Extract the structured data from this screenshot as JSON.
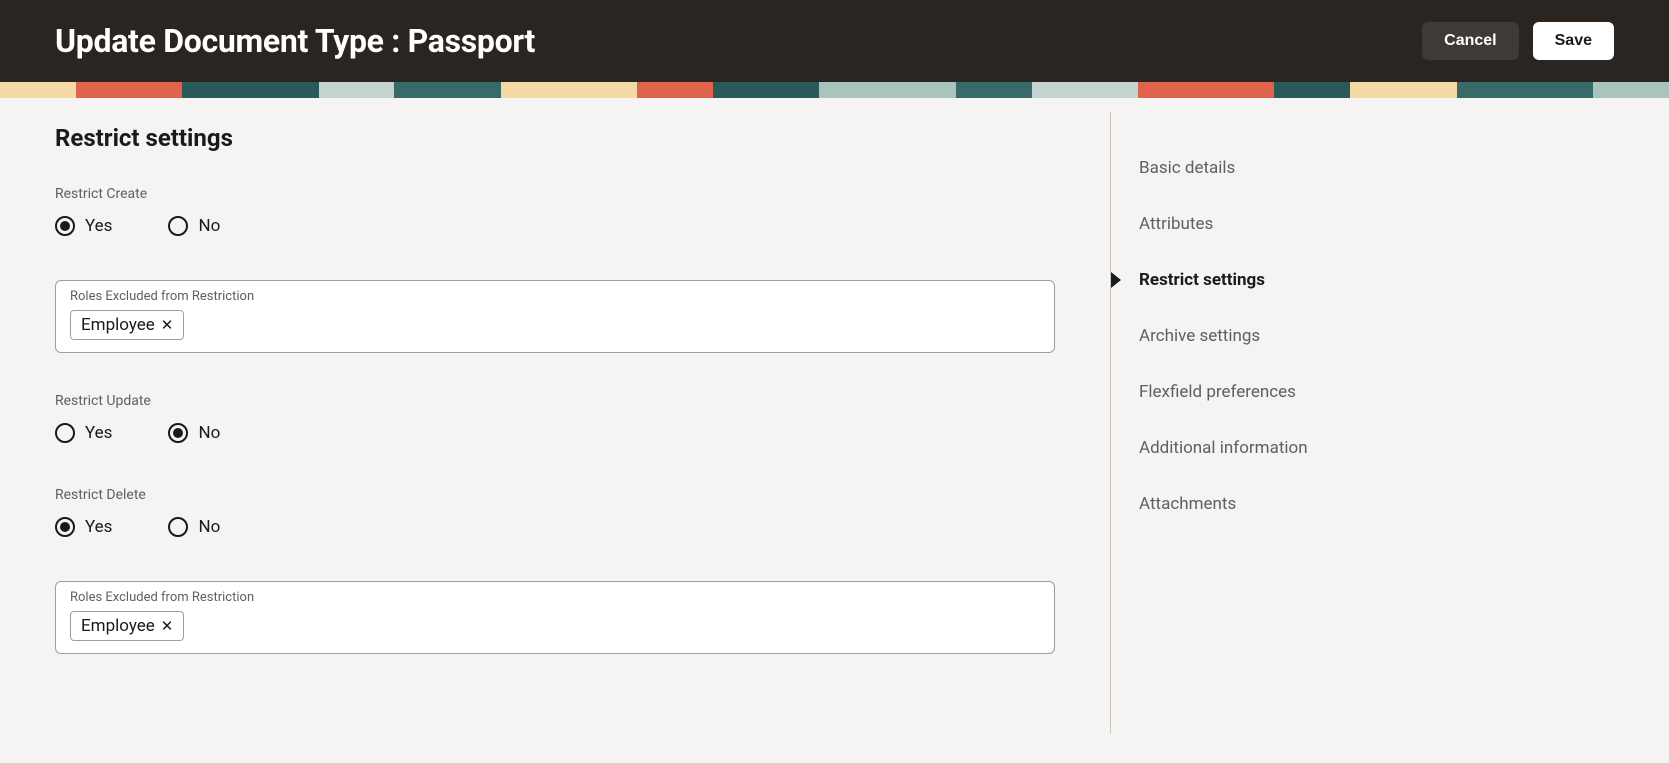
{
  "header": {
    "title": "Update Document Type : Passport",
    "cancel": "Cancel",
    "save": "Save"
  },
  "section": {
    "title": "Restrict settings"
  },
  "restrictCreate": {
    "label": "Restrict Create",
    "yes": "Yes",
    "no": "No",
    "value": "yes",
    "rolesLabel": "Roles Excluded from Restriction",
    "roles": [
      "Employee"
    ]
  },
  "restrictUpdate": {
    "label": "Restrict Update",
    "yes": "Yes",
    "no": "No",
    "value": "no"
  },
  "restrictDelete": {
    "label": "Restrict Delete",
    "yes": "Yes",
    "no": "No",
    "value": "yes",
    "rolesLabel": "Roles Excluded from Restriction",
    "roles": [
      "Employee"
    ]
  },
  "nav": {
    "items": [
      {
        "label": "Basic details",
        "active": false
      },
      {
        "label": "Attributes",
        "active": false
      },
      {
        "label": "Restrict settings",
        "active": true
      },
      {
        "label": "Archive settings",
        "active": false
      },
      {
        "label": "Flexfield preferences",
        "active": false
      },
      {
        "label": "Additional information",
        "active": false
      },
      {
        "label": "Attachments",
        "active": false
      }
    ]
  },
  "bannerColors": [
    "#f5d9a5",
    "#e0634b",
    "#2a5a58",
    "#c3d4d0",
    "#386a6a",
    "#f5d9a5",
    "#e0634b",
    "#2a5a58",
    "#a9c4bd",
    "#386a6a",
    "#c3d4d0",
    "#e0634b",
    "#2a5a58",
    "#f5d9a5",
    "#386a6a",
    "#a9c4bd"
  ]
}
